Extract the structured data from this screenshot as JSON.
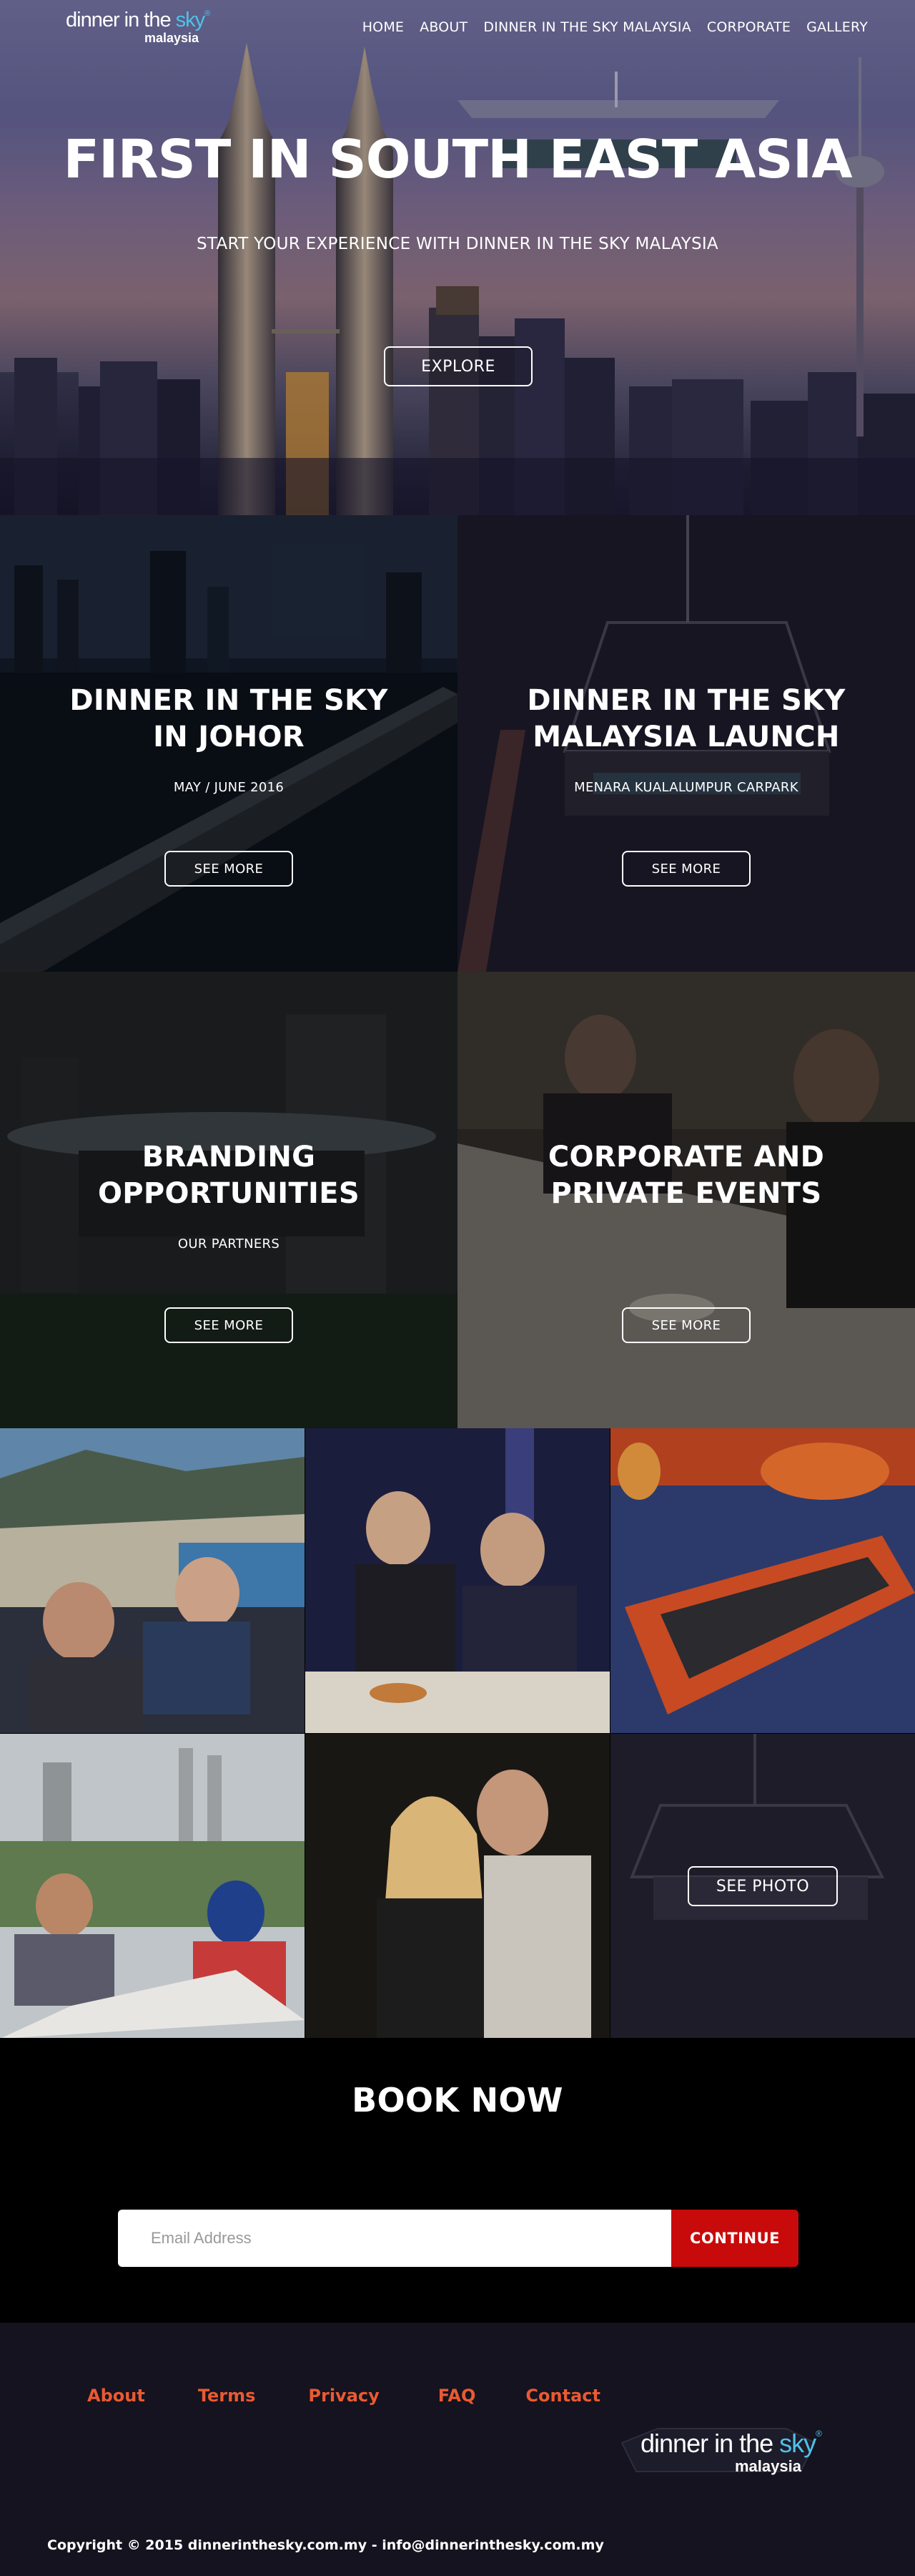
{
  "brand": {
    "part1": "dinner in the ",
    "part2": "sky",
    "reg": "®",
    "sub": "malaysia"
  },
  "nav": [
    "HOME",
    "ABOUT",
    "DINNER IN THE SKY MALAYSIA",
    "CORPORATE",
    "GALLERY"
  ],
  "hero": {
    "title": "FIRST IN SOUTH EAST ASIA",
    "subtitle": "START YOUR EXPERIENCE WITH DINNER IN THE SKY MALAYSIA",
    "button": "EXPLORE"
  },
  "tiles": [
    {
      "title1": "DINNER IN THE SKY",
      "title2": "IN JOHOR",
      "sub": "MAY / JUNE 2016",
      "button": "SEE MORE"
    },
    {
      "title1": "DINNER IN THE SKY",
      "title2": "MALAYSIA LAUNCH",
      "sub": "MENARA KUALALUMPUR CARPARK",
      "button": "SEE MORE"
    },
    {
      "title1": "BRANDING",
      "title2": "OPPORTUNITIES",
      "sub": "OUR PARTNERS",
      "button": "SEE MORE"
    },
    {
      "title1": "CORPORATE AND",
      "title2": "PRIVATE EVENTS",
      "sub": "",
      "button": "SEE MORE"
    }
  ],
  "gallery": {
    "button": "SEE PHOTO"
  },
  "book": {
    "title": "BOOK NOW",
    "placeholder": "Email Address",
    "button": "CONTINUE"
  },
  "footer": {
    "links": [
      "About",
      "Terms",
      "Privacy",
      "FAQ",
      "Contact"
    ],
    "copyright": "Copyright © 2015 dinnerinthesky.com.my - info@dinnerinthesky.com.my"
  },
  "colors": {
    "accent_red": "#c90a0a",
    "footer_link": "#ea5a31",
    "sky_blue": "#4ec3ea",
    "footer_bg": "#14131f"
  }
}
